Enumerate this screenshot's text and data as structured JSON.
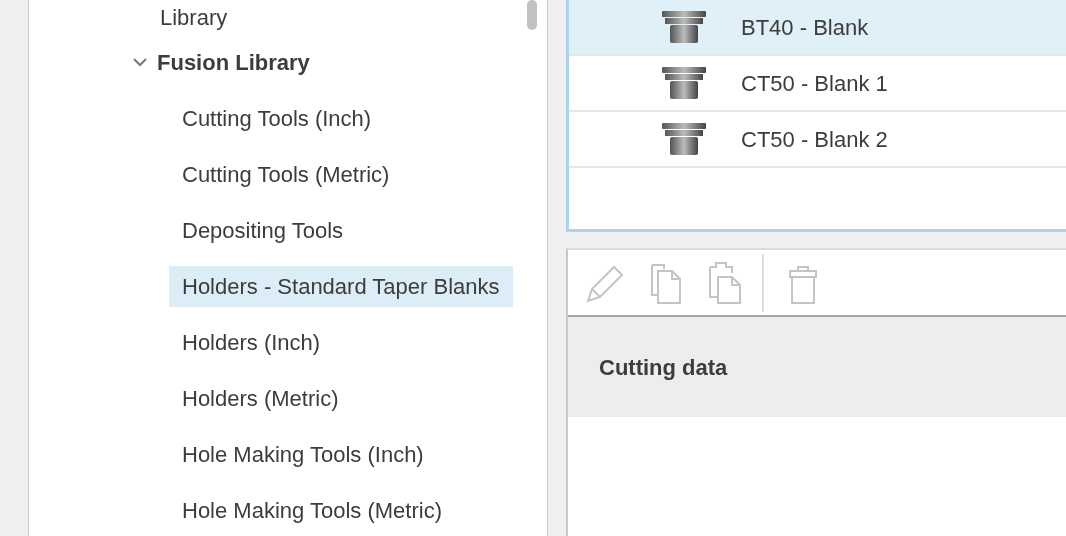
{
  "library_tree": {
    "items": [
      {
        "label": "Library",
        "selected": false
      },
      {
        "label": "Fusion Library",
        "selected": false,
        "expanded": true,
        "children": [
          {
            "label": "Cutting Tools (Inch)",
            "selected": false
          },
          {
            "label": "Cutting Tools (Metric)",
            "selected": false
          },
          {
            "label": "Depositing Tools",
            "selected": false
          },
          {
            "label": "Holders - Standard Taper Blanks",
            "selected": true
          },
          {
            "label": "Holders (Inch)",
            "selected": false
          },
          {
            "label": "Holders (Metric)",
            "selected": false
          },
          {
            "label": "Hole Making Tools (Inch)",
            "selected": false
          },
          {
            "label": "Hole Making Tools (Metric)",
            "selected": false
          }
        ]
      }
    ]
  },
  "holder_list": [
    {
      "name": "BT40 - Blank",
      "selected": true
    },
    {
      "name": "CT50 - Blank 1",
      "selected": false
    },
    {
      "name": "CT50 - Blank 2",
      "selected": false
    }
  ],
  "toolbar": [
    {
      "kind": "edit",
      "disabled": true
    },
    {
      "kind": "copy",
      "disabled": true
    },
    {
      "kind": "paste",
      "disabled": true
    },
    {
      "kind": "separator"
    },
    {
      "kind": "delete",
      "disabled": true
    }
  ],
  "section_header": "Cutting data"
}
